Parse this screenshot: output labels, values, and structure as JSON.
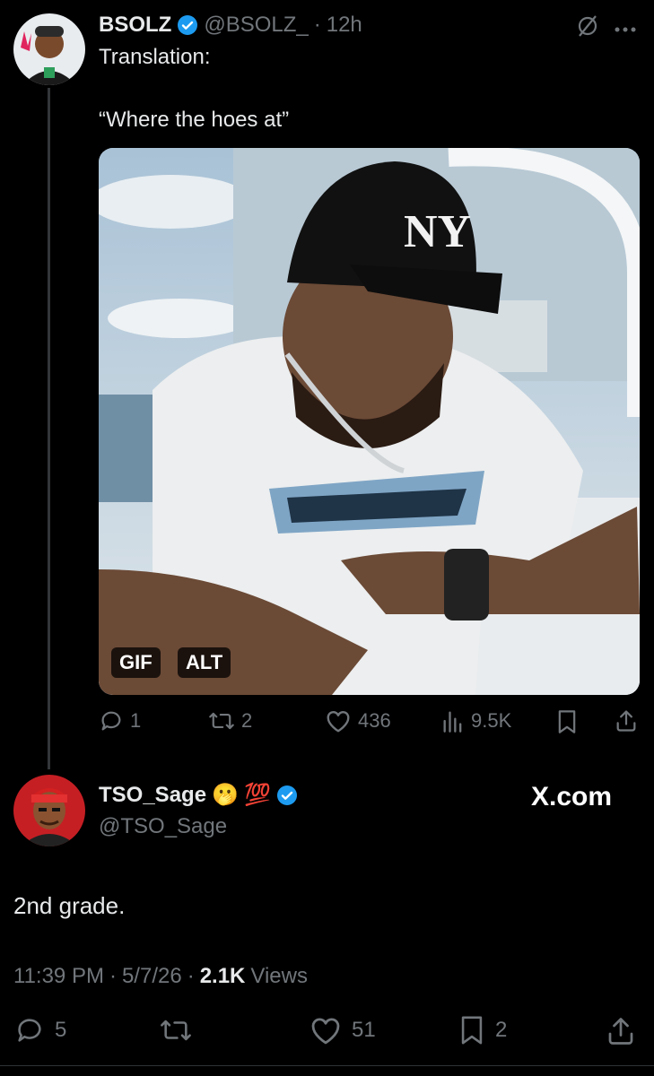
{
  "original": {
    "display_name": "BSOLZ",
    "handle": "@BSOLZ_",
    "separator": "·",
    "time": "12h",
    "text_line1": "Translation:",
    "text_line2": "“Where the hoes at”",
    "media_badges": [
      "GIF",
      "ALT"
    ],
    "actions": {
      "replies": "1",
      "reposts": "2",
      "likes": "436",
      "views": "9.5K"
    }
  },
  "reply": {
    "display_name": "TSO_Sage",
    "emoji_1": "🫢",
    "emoji_2": "💯",
    "handle": "@TSO_Sage",
    "text": "2nd grade.",
    "watermark": "X.com",
    "timestamp": "11:39 PM",
    "date": "5/7/26",
    "separator": "·",
    "views_count": "2.1K",
    "views_label": "Views",
    "actions": {
      "replies": "5",
      "likes": "51",
      "bookmarks": "2"
    }
  },
  "colors": {
    "background": "#000000",
    "text": "#e7e9ea",
    "muted": "#71767b",
    "verified": "#1d9bf0"
  }
}
